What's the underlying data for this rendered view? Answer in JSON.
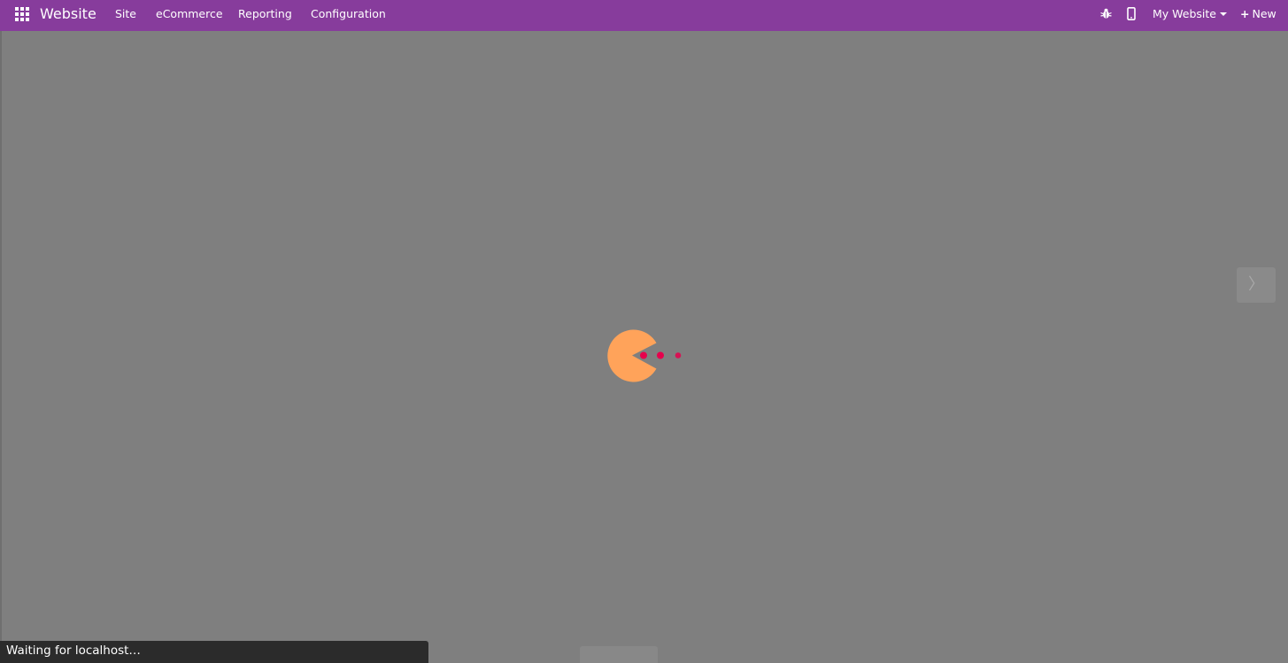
{
  "navbar": {
    "brand": "Website",
    "menu": [
      "Site",
      "eCommerce",
      "Reporting",
      "Configuration"
    ],
    "website_selector": "My Website",
    "new_label": "New",
    "colors": {
      "navbar_bg": "#873c9c",
      "overlay_bg": "#7f7f7f",
      "pacman": "#ffa35a",
      "dots": "#e6004c"
    }
  },
  "icons": {
    "apps": "apps-grid-icon",
    "debug": "bug-icon",
    "mobile": "mobile-icon",
    "next": "chevron-right-icon"
  },
  "content": {
    "next_glyph": "〉"
  },
  "status": {
    "text": "Waiting for localhost…"
  }
}
